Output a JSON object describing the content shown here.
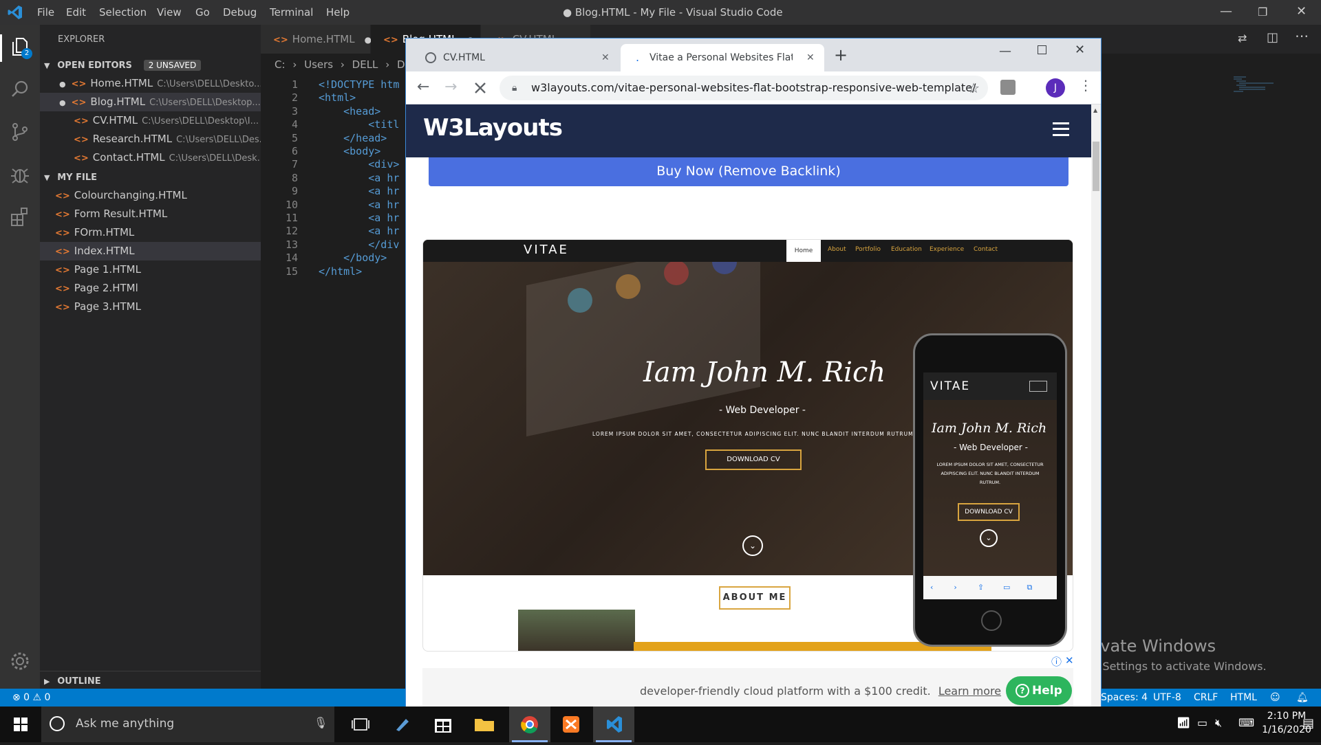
{
  "vscode": {
    "window_title": "● Blog.HTML - My File - Visual Studio Code",
    "menu": [
      "File",
      "Edit",
      "Selection",
      "View",
      "Go",
      "Debug",
      "Terminal",
      "Help"
    ],
    "sidebar": {
      "title": "EXPLORER",
      "open_editors_label": "OPEN EDITORS",
      "unsaved_badge": "2 UNSAVED",
      "open_editors": [
        {
          "name": "Home.HTML",
          "path": "C:\\Users\\DELL\\Deskto...",
          "unsaved": true
        },
        {
          "name": "Blog.HTML",
          "path": "C:\\Users\\DELL\\Desktop...",
          "unsaved": true
        },
        {
          "name": "CV.HTML",
          "path": "C:\\Users\\DELL\\Desktop\\I...",
          "unsaved": false
        },
        {
          "name": "Research.HTML",
          "path": "C:\\Users\\DELL\\Des...",
          "unsaved": false
        },
        {
          "name": "Contact.HTML",
          "path": "C:\\Users\\DELL\\Desk...",
          "unsaved": false
        }
      ],
      "folder_label": "MY FILE",
      "files": [
        "Colourchanging.HTML",
        "Form Result.HTML",
        "FOrm.HTML",
        "Index.HTML",
        "Page 1.HTML",
        "Page 2.HTMl",
        "Page 3.HTML"
      ],
      "outline_label": "OUTLINE",
      "activity_badge": "2"
    },
    "editor_tabs": [
      {
        "label": "Home.HTML",
        "dirty": true
      },
      {
        "label": "Blog.HTML",
        "dirty": true
      },
      {
        "label": "CV.HTML",
        "dirty": false
      }
    ],
    "breadcrumb": [
      "C:",
      "Users",
      "DELL",
      "Deskt"
    ],
    "code_lines": [
      {
        "n": "1",
        "text": "<!DOCTYPE htm"
      },
      {
        "n": "2",
        "text": "<html>"
      },
      {
        "n": "3",
        "text": "    <head>"
      },
      {
        "n": "4",
        "text": "        <titl"
      },
      {
        "n": "5",
        "text": "    </head>"
      },
      {
        "n": "6",
        "text": "    <body>"
      },
      {
        "n": "7",
        "text": "        <div>"
      },
      {
        "n": "8",
        "text": "        <a hr"
      },
      {
        "n": "9",
        "text": "        <a hr"
      },
      {
        "n": "10",
        "text": "        <a hr"
      },
      {
        "n": "11",
        "text": "        <a hr"
      },
      {
        "n": "12",
        "text": "        <a hr"
      },
      {
        "n": "13",
        "text": "        </div"
      },
      {
        "n": "14",
        "text": "    </body>"
      },
      {
        "n": "15",
        "text": "</html>"
      }
    ],
    "status": {
      "problems": "⊗ 0 ⚠ 0",
      "spaces": "Spaces: 4",
      "encoding": "UTF-8",
      "eol": "CRLF",
      "language": "HTML"
    }
  },
  "chrome": {
    "tabs": [
      {
        "label": "CV.HTML",
        "active": false
      },
      {
        "label": "Vitae a Personal Websites Flat Bo",
        "active": true
      }
    ],
    "url": "w3layouts.com/vitae-personal-websites-flat-bootstrap-responsive-web-template/",
    "profile_initial": "J",
    "page": {
      "brand": "W3Layouts",
      "buy_button": "Buy Now (Remove Backlink)",
      "preview": {
        "logo": "VITAE",
        "nav": [
          "Home",
          "About",
          "Portfolio",
          "Education",
          "Experience",
          "Contact"
        ],
        "headline": "Iam John M. Rich",
        "role": "- Web Developer -",
        "lorem": "LOREM IPSUM DOLOR SIT AMET, CONSECTETUR ADIPISCING ELIT. NUNC BLANDIT INTERDUM RUTRUM.",
        "download": "DOWNLOAD CV",
        "about": "ABOUT ME",
        "mobile_lorem": [
          "LOREM IPSUM DOLOR SIT AMET, CONSECTETUR",
          "ADIPISCING ELIT. NUNC BLANDIT INTERDUM",
          "RUTRUM."
        ]
      },
      "help_button": "Help",
      "ad_text": "developer-friendly cloud platform with a $100 credit.",
      "ad_link": "Learn more"
    }
  },
  "watermark": {
    "title": "Activate Windows",
    "subtitle": "Go to Settings to activate Windows."
  },
  "taskbar": {
    "search_placeholder": "Ask me anything",
    "time": "2:10 PM",
    "date": "1/16/2020"
  },
  "colors": {
    "vscode_blue": "#007acc",
    "w3_navy": "#1e2a4a",
    "buy_blue": "#4a6fe0",
    "help_green": "#2db55d",
    "gold": "#e3a21a"
  }
}
